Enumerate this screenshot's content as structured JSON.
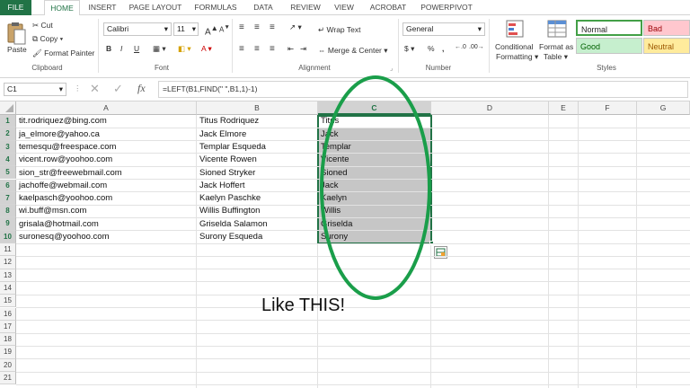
{
  "tabs": [
    "FILE",
    "HOME",
    "INSERT",
    "PAGE LAYOUT",
    "FORMULAS",
    "DATA",
    "REVIEW",
    "VIEW",
    "ACROBAT",
    "POWERPIVOT"
  ],
  "ribbon": {
    "clipboard": {
      "paste": "Paste",
      "cut": "Cut",
      "copy": "Copy",
      "format_painter": "Format Painter",
      "label": "Clipboard"
    },
    "font": {
      "name": "Calibri",
      "size": "11",
      "bold": "B",
      "italic": "I",
      "underline": "U",
      "grow": "A",
      "shrink": "A",
      "label": "Font"
    },
    "alignment": {
      "wrap_text": "Wrap Text",
      "merge_center": "Merge & Center",
      "label": "Alignment"
    },
    "number": {
      "format": "General",
      "currency": "$",
      "percent": "%",
      "comma": ",",
      "label": "Number"
    },
    "styles": {
      "conditional": "Conditional",
      "formatting": "Formatting",
      "format_as": "Format as",
      "table": "Table",
      "normal": "Normal",
      "bad": "Bad",
      "good": "Good",
      "neutral": "Neutral",
      "label": "Styles"
    }
  },
  "formula_bar": {
    "name_box": "C1",
    "cancel": "✕",
    "enter": "✓",
    "fx": "fx",
    "formula": "=LEFT(B1,FIND(\" \",B1,1)-1)"
  },
  "columns": [
    "A",
    "B",
    "C",
    "D",
    "E",
    "F",
    "G"
  ],
  "rows": [
    "1",
    "2",
    "3",
    "4",
    "5",
    "6",
    "7",
    "8",
    "9",
    "10",
    "11",
    "12",
    "13",
    "14",
    "15",
    "16",
    "17",
    "18",
    "19",
    "20",
    "21"
  ],
  "data": {
    "col_a": [
      "tit.rodriquez@bing.com",
      "ja_elmore@yahoo.ca",
      "temesqu@freespace.com",
      "vicent.row@yoohoo.com",
      "sion_str@freewebmail.com",
      "jachoffe@webmail.com",
      "kaelpasch@yoohoo.com",
      "wi.buff@msn.com",
      "grisala@hotmail.com",
      "suronesq@yoohoo.com"
    ],
    "col_b": [
      "Titus Rodriquez",
      "Jack Elmore",
      "Templar Esqueda",
      "Vicente Rowen",
      "Sioned Stryker",
      "Jack Hoffert",
      "Kaelyn Paschke",
      "Willis Buffington",
      "Griselda Salamon",
      "Surony Esqueda"
    ],
    "col_c": [
      "Titus",
      "Jack",
      "Templar",
      "Vicente",
      "Sioned",
      "Jack",
      "Kaelyn",
      "Willis",
      "Griselda",
      "Surony"
    ]
  },
  "annotation": "Like THIS!",
  "colors": {
    "accent": "#217346",
    "highlight": "#1a9e4a",
    "selection": "#c6c6c6"
  }
}
